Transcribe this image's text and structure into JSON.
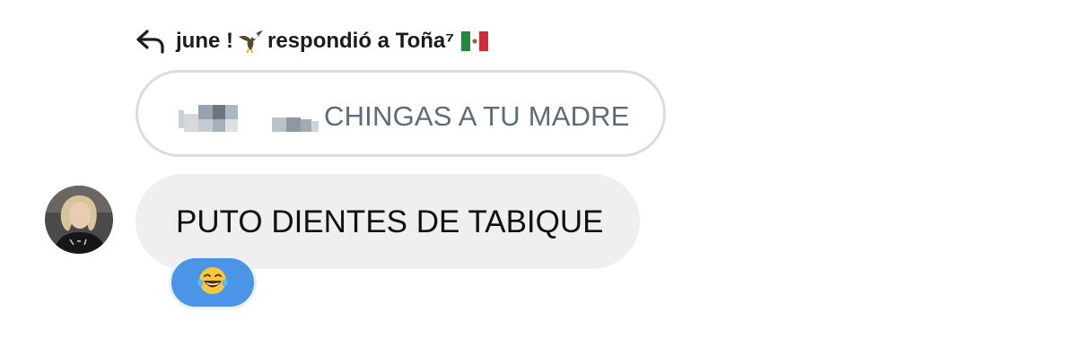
{
  "reply_header": {
    "name": "june ! ",
    "bird_emoji": "eagle-emoji",
    "action": "respondió a Toña⁷",
    "flag_emoji": "mexico-flag-emoji"
  },
  "quoted_message": {
    "text": "CHINGAS A TU MADRE",
    "redacted": true
  },
  "message": {
    "text": "PUTO DIENTES DE TABIQUE"
  },
  "reaction": {
    "emoji": "😂"
  },
  "colors": {
    "bubble_bg": "#efefef",
    "quoted_border": "#dcdcdc",
    "quoted_text": "#5f6b78",
    "reaction_bg": "#4a95e7"
  }
}
